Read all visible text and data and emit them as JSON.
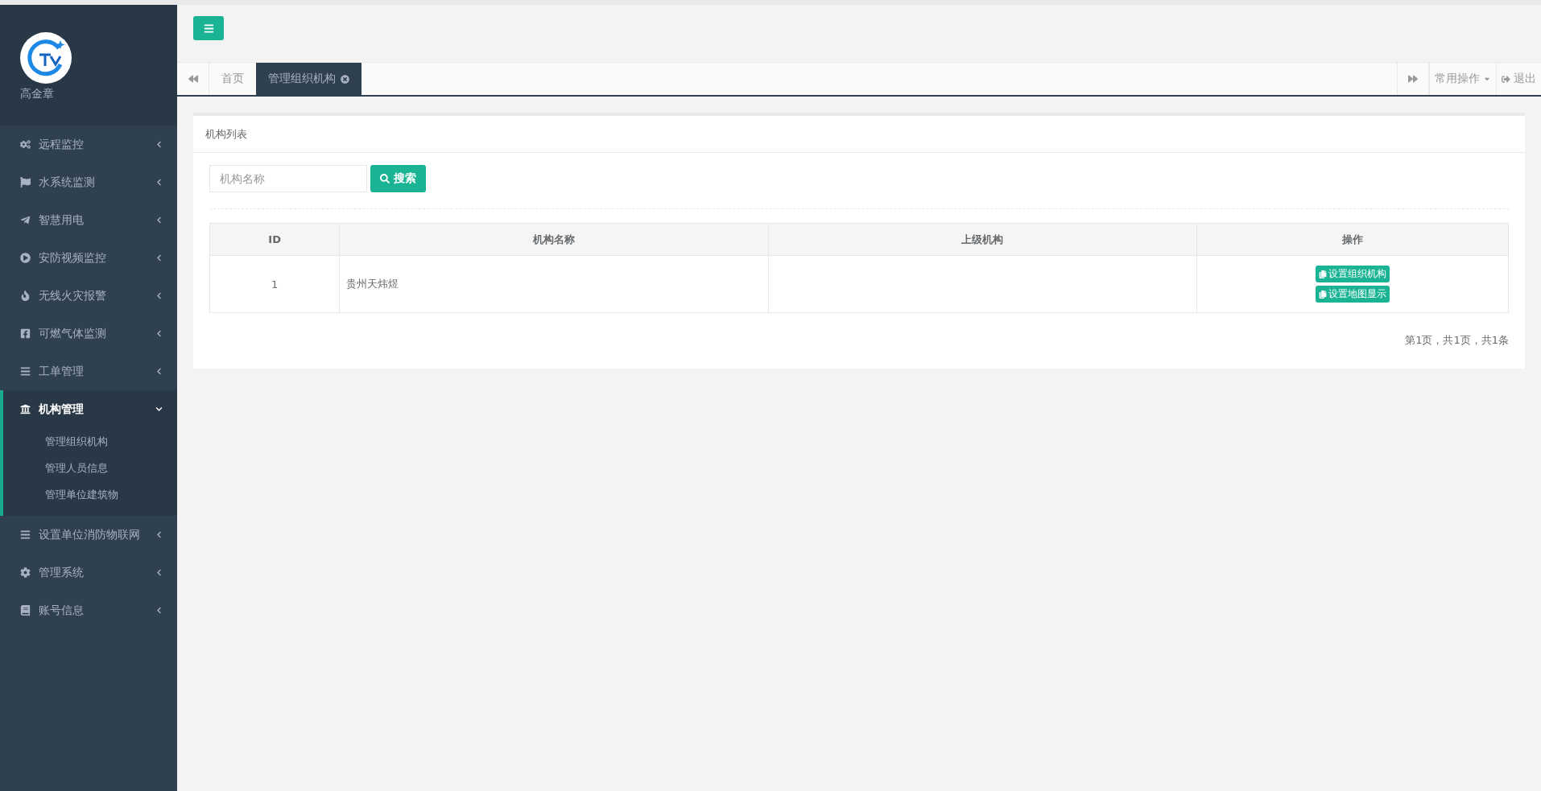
{
  "sidebar": {
    "user": {
      "name": "高金章"
    },
    "menu": [
      {
        "label": "远程监控",
        "expanded": false
      },
      {
        "label": "水系统监测",
        "expanded": false
      },
      {
        "label": "智慧用电",
        "expanded": false
      },
      {
        "label": "安防视频监控",
        "expanded": false
      },
      {
        "label": "无线火灾报警",
        "expanded": false
      },
      {
        "label": "可燃气体监测",
        "expanded": false
      },
      {
        "label": "工单管理",
        "expanded": false
      },
      {
        "label": "机构管理",
        "expanded": true,
        "children": [
          {
            "label": "管理组织机构"
          },
          {
            "label": "管理人员信息"
          },
          {
            "label": "管理单位建筑物"
          }
        ]
      },
      {
        "label": "设置单位消防物联网",
        "expanded": false
      },
      {
        "label": "管理系统",
        "expanded": false
      },
      {
        "label": "账号信息",
        "expanded": false
      }
    ]
  },
  "tabs": [
    {
      "label": "首页",
      "selected": false,
      "closable": false
    },
    {
      "label": "管理组织机构",
      "selected": true,
      "closable": true
    }
  ],
  "toolbar": {
    "operations": "常用操作",
    "logout": "退出"
  },
  "card": {
    "title": "机构列表",
    "search": {
      "placeholder": "机构名称",
      "button": "搜索"
    },
    "table": {
      "columns": [
        "ID",
        "机构名称",
        "上级机构",
        "操作"
      ],
      "rows": [
        {
          "id": "1",
          "name": "贵州天炜煜",
          "parent": "",
          "actions": [
            "设置组织机构",
            "设置地图显示"
          ]
        }
      ]
    },
    "pager": "第1页，共1页，共1条"
  }
}
